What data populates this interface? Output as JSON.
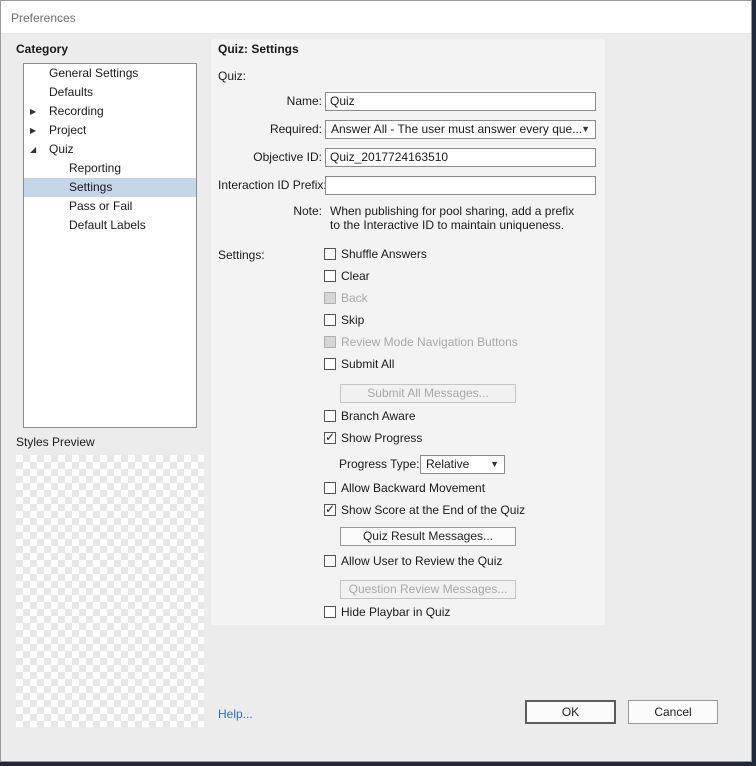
{
  "window": {
    "title": "Preferences"
  },
  "category": {
    "heading": "Category",
    "items": [
      {
        "label": "General Settings",
        "expandable": false,
        "selected": false
      },
      {
        "label": "Defaults",
        "expandable": false,
        "selected": false
      },
      {
        "label": "Recording",
        "expandable": true,
        "expanded": false,
        "selected": false
      },
      {
        "label": "Project",
        "expandable": true,
        "expanded": false,
        "selected": false
      },
      {
        "label": "Quiz",
        "expandable": true,
        "expanded": true,
        "selected": false
      },
      {
        "label": "Reporting",
        "expandable": false,
        "selected": false
      },
      {
        "label": "Settings",
        "expandable": false,
        "selected": true
      },
      {
        "label": "Pass or Fail",
        "expandable": false,
        "selected": false
      },
      {
        "label": "Default Labels",
        "expandable": false,
        "selected": false
      }
    ]
  },
  "styles_preview": {
    "heading": "Styles Preview"
  },
  "quiz_settings": {
    "title": "Quiz: Settings",
    "quiz_section_label": "Quiz:",
    "name_label": "Name:",
    "name_value": "Quiz",
    "required_label": "Required:",
    "required_value": "Answer All - The user must answer every que...",
    "objective_label": "Objective ID:",
    "objective_value": "Quiz_2017724163510",
    "interaction_label": "Interaction ID Prefix:",
    "interaction_value": "",
    "note_label": "Note:",
    "note_line1": "When publishing for pool sharing, add a prefix",
    "note_line2": "to the Interactive ID to maintain uniqueness.",
    "settings_label": "Settings:",
    "checkboxes": {
      "shuffle_answers": {
        "label": "Shuffle Answers",
        "checked": false,
        "enabled": true
      },
      "clear": {
        "label": "Clear",
        "checked": false,
        "enabled": true
      },
      "back": {
        "label": "Back",
        "checked": false,
        "enabled": false
      },
      "skip": {
        "label": "Skip",
        "checked": false,
        "enabled": true
      },
      "review_nav": {
        "label": "Review Mode Navigation Buttons",
        "checked": false,
        "enabled": false
      },
      "submit_all": {
        "label": "Submit All",
        "checked": false,
        "enabled": true
      },
      "branch_aware": {
        "label": "Branch Aware",
        "checked": false,
        "enabled": true
      },
      "show_progress": {
        "label": "Show Progress",
        "checked": true,
        "enabled": true
      },
      "allow_backward": {
        "label": "Allow Backward Movement",
        "checked": false,
        "enabled": true
      },
      "show_score": {
        "label": "Show Score at the End of the Quiz",
        "checked": true,
        "enabled": true
      },
      "allow_review": {
        "label": "Allow User to Review the Quiz",
        "checked": false,
        "enabled": true
      },
      "hide_playbar": {
        "label": "Hide Playbar in Quiz",
        "checked": false,
        "enabled": true
      }
    },
    "submit_all_messages_button": "Submit All Messages...",
    "progress_type_label": "Progress Type:",
    "progress_type_value": "Relative",
    "quiz_result_messages_button": "Quiz Result Messages...",
    "question_review_messages_button": "Question Review Messages..."
  },
  "footer": {
    "help_link": "Help...",
    "ok_button": "OK",
    "cancel_button": "Cancel"
  },
  "icons": {
    "checkmark": "✓",
    "dropdown_caret": "▼",
    "tree_collapsed": "▶",
    "tree_expanded": "◢"
  }
}
